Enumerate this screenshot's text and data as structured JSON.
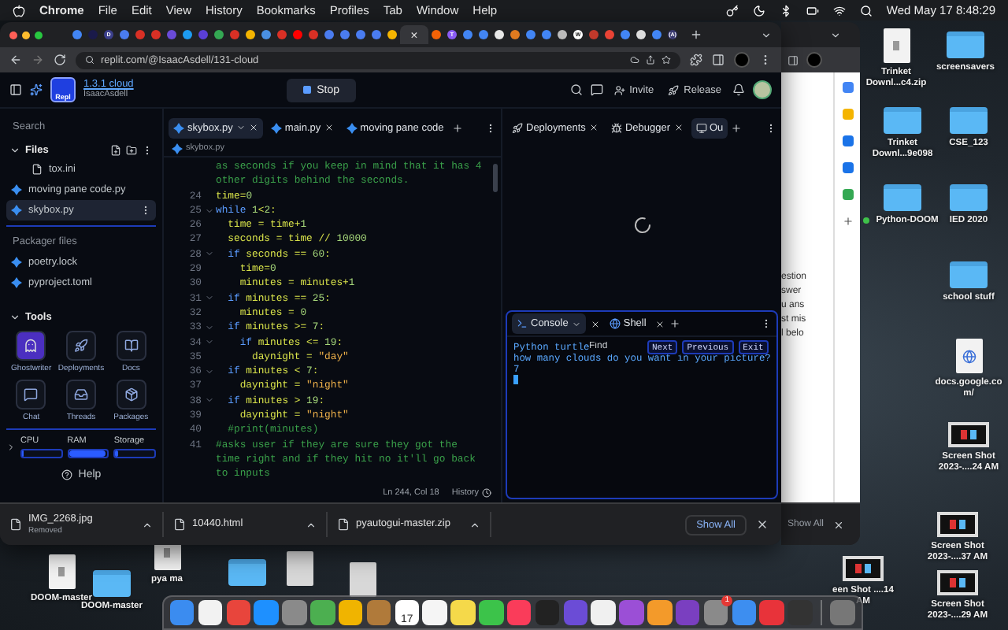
{
  "menu_bar": {
    "app": "Chrome",
    "items": [
      "File",
      "Edit",
      "View",
      "History",
      "Bookmarks",
      "Profiles",
      "Tab",
      "Window",
      "Help"
    ],
    "clock": "Wed May 17 8:48:29"
  },
  "browser": {
    "tabs": [
      {
        "color": "#4285f4",
        "selected": false
      },
      {
        "color": "#1a1a4a",
        "selected": false
      },
      {
        "color": "#3b3f8c",
        "glyph": "D",
        "selected": false
      },
      {
        "color": "#4a7cf0",
        "selected": false
      },
      {
        "color": "#d93025",
        "selected": false
      },
      {
        "color": "#d93025",
        "selected": false
      },
      {
        "color": "#6a4bd8",
        "selected": false
      },
      {
        "color": "#1d9bf0",
        "selected": false
      },
      {
        "color": "#5b3fd6",
        "selected": false
      },
      {
        "color": "#34a853",
        "selected": false
      },
      {
        "color": "#d93025",
        "selected": false
      },
      {
        "color": "#f4b400",
        "selected": false
      },
      {
        "color": "#4a90e2",
        "selected": false
      },
      {
        "color": "#d93025",
        "selected": false
      },
      {
        "color": "#ff0000",
        "selected": false
      },
      {
        "color": "#d93025",
        "selected": false
      },
      {
        "color": "#4a7cf0",
        "selected": false
      },
      {
        "color": "#4a7cf0",
        "selected": false
      },
      {
        "color": "#4a7cf0",
        "selected": false
      },
      {
        "color": "#4a7cf0",
        "selected": false
      },
      {
        "color": "#f4b400",
        "selected": false
      },
      {
        "selected": true
      },
      {
        "color": "#f26207",
        "selected": false
      },
      {
        "color": "#8a5cf5",
        "glyph": "T",
        "selected": false
      },
      {
        "color": "#4285f4",
        "selected": false
      },
      {
        "color": "#4285f4",
        "selected": false
      },
      {
        "color": "#e8e8e8",
        "selected": false
      },
      {
        "color": "#e07a1f",
        "selected": false
      },
      {
        "color": "#4285f4",
        "selected": false
      },
      {
        "color": "#4285f4",
        "selected": false
      },
      {
        "color": "#bbbbbb",
        "selected": false
      },
      {
        "color": "#ffffff",
        "glyph": "W",
        "selected": false
      },
      {
        "color": "#c0392b",
        "selected": false
      },
      {
        "color": "#ea4335",
        "selected": false
      },
      {
        "color": "#4285f4",
        "selected": false
      },
      {
        "color": "#dddddd",
        "selected": false
      },
      {
        "color": "#4285f4",
        "selected": false
      },
      {
        "color": "#3a3a70",
        "glyph": "(A)",
        "selected": false
      }
    ],
    "tab_close": "×",
    "address": "replit.com/@IsaacAsdell/131-cloud"
  },
  "replit": {
    "logo": "Repl",
    "repl_name": "1.3.1 cloud",
    "owner": "IsaacAsdell",
    "run_button": "Stop",
    "invite": "Invite",
    "release": "Release",
    "sidebar": {
      "search": "Search",
      "files_heading": "Files",
      "files": [
        {
          "name": "tox.ini",
          "kind": "plain",
          "selected": false
        },
        {
          "name": "moving pane code.py",
          "kind": "python",
          "selected": false
        },
        {
          "name": "skybox.py",
          "kind": "python",
          "selected": true
        }
      ],
      "packager_heading": "Packager files",
      "packager_files": [
        {
          "name": "poetry.lock",
          "kind": "python",
          "selected": false
        },
        {
          "name": "pyproject.toml",
          "kind": "python",
          "selected": false
        }
      ],
      "tools_heading": "Tools",
      "tools": [
        {
          "label": "Ghostwriter",
          "kind": "ghost",
          "selected": true
        },
        {
          "label": "Deployments",
          "kind": "deploy",
          "selected": false
        },
        {
          "label": "Docs",
          "kind": "docs",
          "selected": false
        },
        {
          "label": "Chat",
          "kind": "chat",
          "selected": false
        },
        {
          "label": "Threads",
          "kind": "threads",
          "selected": false
        },
        {
          "label": "Packages",
          "kind": "packages",
          "selected": false
        }
      ],
      "meters": [
        {
          "label": "CPU",
          "level": 0.06
        },
        {
          "label": "RAM",
          "level": 0.95
        },
        {
          "label": "Storage",
          "level": 0.06
        }
      ],
      "help": "Help"
    },
    "editor": {
      "tabs": [
        {
          "label": "skybox.py",
          "selected": true
        },
        {
          "label": "main.py",
          "selected": false
        },
        {
          "label": "moving pane code",
          "selected": false
        }
      ],
      "breadcrumb": "skybox.py",
      "lines": [
        {
          "fold": false,
          "parts": [
            {
              "kind": "cm",
              "t": "as seconds if you keep in mind that it has 4"
            }
          ]
        },
        {
          "fold": false,
          "parts": [
            {
              "kind": "cm",
              "t": "other digits behind the seconds."
            }
          ]
        },
        {
          "n": "24",
          "fold": false,
          "parts": [
            {
              "kind": "id",
              "t": "time="
            },
            {
              "kind": "num",
              "t": "0"
            }
          ]
        },
        {
          "n": "25",
          "fold": true,
          "parts": [
            {
              "kind": "kw",
              "t": "while "
            },
            {
              "kind": "num",
              "t": "1"
            },
            {
              "kind": "id",
              "t": "<"
            },
            {
              "kind": "num",
              "t": "2"
            },
            {
              "kind": "id",
              "t": ":"
            }
          ]
        },
        {
          "n": "26",
          "fold": false,
          "parts": [
            {
              "kind": "id",
              "t": "  time = time+"
            },
            {
              "kind": "num",
              "t": "1"
            }
          ]
        },
        {
          "n": "27",
          "fold": false,
          "parts": [
            {
              "kind": "id",
              "t": "  seconds = time // "
            },
            {
              "kind": "num",
              "t": "10000"
            }
          ]
        },
        {
          "n": "28",
          "fold": true,
          "parts": [
            {
              "kind": "kw",
              "t": "  if"
            },
            {
              "kind": "id",
              "t": " seconds == "
            },
            {
              "kind": "num",
              "t": "60"
            },
            {
              "kind": "id",
              "t": ":"
            }
          ]
        },
        {
          "n": "29",
          "fold": false,
          "parts": [
            {
              "kind": "id",
              "t": "    time="
            },
            {
              "kind": "num",
              "t": "0"
            }
          ]
        },
        {
          "n": "30",
          "fold": false,
          "parts": [
            {
              "kind": "id",
              "t": "    minutes = minutes+"
            },
            {
              "kind": "num",
              "t": "1"
            }
          ]
        },
        {
          "n": "31",
          "fold": true,
          "parts": [
            {
              "kind": "kw",
              "t": "  if"
            },
            {
              "kind": "id",
              "t": " minutes == "
            },
            {
              "kind": "num",
              "t": "25"
            },
            {
              "kind": "id",
              "t": ":"
            }
          ]
        },
        {
          "n": "32",
          "fold": false,
          "parts": [
            {
              "kind": "id",
              "t": "    minutes = "
            },
            {
              "kind": "num",
              "t": "0"
            }
          ]
        },
        {
          "n": "33",
          "fold": true,
          "parts": [
            {
              "kind": "kw",
              "t": "  if"
            },
            {
              "kind": "id",
              "t": " minutes >= "
            },
            {
              "kind": "num",
              "t": "7"
            },
            {
              "kind": "id",
              "t": ":"
            }
          ]
        },
        {
          "n": "34",
          "fold": true,
          "parts": [
            {
              "kind": "kw",
              "t": "    if"
            },
            {
              "kind": "id",
              "t": " minutes <= "
            },
            {
              "kind": "num",
              "t": "19"
            },
            {
              "kind": "id",
              "t": ":"
            }
          ]
        },
        {
          "n": "35",
          "fold": false,
          "parts": [
            {
              "kind": "id",
              "t": "      daynight = "
            },
            {
              "kind": "str",
              "t": "\"day\""
            }
          ]
        },
        {
          "n": "36",
          "fold": true,
          "parts": [
            {
              "kind": "kw",
              "t": "  if"
            },
            {
              "kind": "id",
              "t": " minutes < "
            },
            {
              "kind": "num",
              "t": "7"
            },
            {
              "kind": "id",
              "t": ":"
            }
          ]
        },
        {
          "n": "37",
          "fold": false,
          "parts": [
            {
              "kind": "id",
              "t": "    daynight = "
            },
            {
              "kind": "str",
              "t": "\"night\""
            }
          ]
        },
        {
          "n": "38",
          "fold": true,
          "parts": [
            {
              "kind": "kw",
              "t": "  if"
            },
            {
              "kind": "id",
              "t": " minutes > "
            },
            {
              "kind": "num",
              "t": "19"
            },
            {
              "kind": "id",
              "t": ":"
            }
          ]
        },
        {
          "n": "39",
          "fold": false,
          "parts": [
            {
              "kind": "id",
              "t": "    daynight = "
            },
            {
              "kind": "str",
              "t": "\"night\""
            }
          ]
        },
        {
          "n": "40",
          "fold": false,
          "parts": [
            {
              "kind": "cm",
              "t": "  #print(minutes)"
            }
          ]
        },
        {
          "n": "41",
          "fold": false,
          "parts": [
            {
              "kind": "cm",
              "t": "#asks user if they are sure they got the"
            }
          ]
        },
        {
          "fold": false,
          "parts": [
            {
              "kind": "cm",
              "t": "time right and if they hit no it'll go back"
            }
          ]
        },
        {
          "fold": false,
          "parts": [
            {
              "kind": "cm",
              "t": "to inputs"
            }
          ]
        }
      ],
      "status": "Ln 244, Col 18",
      "history": "History"
    },
    "output": {
      "tabs": [
        {
          "label": "Deployments",
          "kind": "deploy",
          "selected": false
        },
        {
          "label": "Debugger",
          "kind": "debug",
          "selected": false
        },
        {
          "label": "Ou",
          "kind": "output",
          "selected": true
        }
      ],
      "console": {
        "tabs": [
          {
            "label": "Console",
            "kind": "console",
            "selected": true
          },
          {
            "label": "Shell",
            "kind": "shell",
            "selected": false
          }
        ],
        "find": {
          "placeholder": "Find",
          "buttons": [
            "Next",
            "Previous",
            "Exit"
          ]
        },
        "lines": [
          "Python turtle",
          "how many clouds do you want in your picture?",
          "7"
        ]
      }
    }
  },
  "downloads": {
    "items": [
      {
        "name": "IMG_2268.jpg",
        "status": "Removed"
      },
      {
        "name": "10440.html"
      },
      {
        "name": "pyautogui-master.zip"
      }
    ],
    "show_all": "Show All"
  },
  "back_window": {
    "lines": [
      "estion",
      "swer",
      "u ans",
      "st mis",
      "l belo"
    ],
    "show_all": "Show All"
  },
  "desktop": {
    "icons": [
      {
        "label": "Trinket Downl...c4.zip",
        "kind": "zip"
      },
      {
        "label": "screensavers",
        "kind": "folder"
      },
      {
        "label": "Trinket Downl...9e098",
        "kind": "folder"
      },
      {
        "label": "CSE_123",
        "kind": "folder"
      },
      {
        "label": "Python-DOOM",
        "kind": "folder",
        "color": "#3fc24a"
      },
      {
        "label": "IED 2020",
        "kind": "folder"
      },
      {
        "label": "school stuff",
        "kind": "folder"
      },
      {
        "label": "docs.google.com/",
        "kind": "web"
      },
      {
        "label": "Screen Shot 2023-....24 AM",
        "kind": "shot"
      },
      {
        "label": "Screen Shot 2023-....37 AM",
        "kind": "shot"
      },
      {
        "label": "een Shot ....14 AM",
        "kind": "shot"
      },
      {
        "label": "Screen Shot 2023-....29 AM",
        "kind": "shot"
      },
      {
        "label": "DOOM-master",
        "kind": "zip"
      },
      {
        "label": "DOOM-master",
        "kind": "folder"
      },
      {
        "label": "pya ma",
        "kind": "zip"
      },
      {
        "kind": "folder"
      },
      {
        "kind": "doc"
      },
      {
        "kind": "doc"
      }
    ]
  },
  "dock": {
    "apps": [
      {
        "color": "#3b8cf0"
      },
      {
        "color": "#f2f2f2"
      },
      {
        "color": "#e8453c"
      },
      {
        "color": "#1e90ff"
      },
      {
        "color": "#8a8a8a"
      },
      {
        "color": "#4caf50"
      },
      {
        "color": "#f0b400"
      },
      {
        "color": "#b07a3a"
      },
      {
        "color": "#ffffff",
        "text": "17"
      },
      {
        "color": "#f5f5f5"
      },
      {
        "color": "#f5d94a"
      },
      {
        "color": "#3cc34a"
      },
      {
        "color": "#fa3c5a"
      },
      {
        "color": "#222222"
      },
      {
        "color": "#6b4cd6"
      },
      {
        "color": "#f0f0f0"
      },
      {
        "color": "#9b4fd6"
      },
      {
        "color": "#f39a2a"
      },
      {
        "color": "#7a3fc0"
      },
      {
        "color": "#8a8a8a",
        "badge": "1"
      },
      {
        "color": "#3d8ef0"
      },
      {
        "color": "#e8333a"
      },
      {
        "color": "#333333"
      },
      {
        "color": "#777777"
      }
    ]
  }
}
